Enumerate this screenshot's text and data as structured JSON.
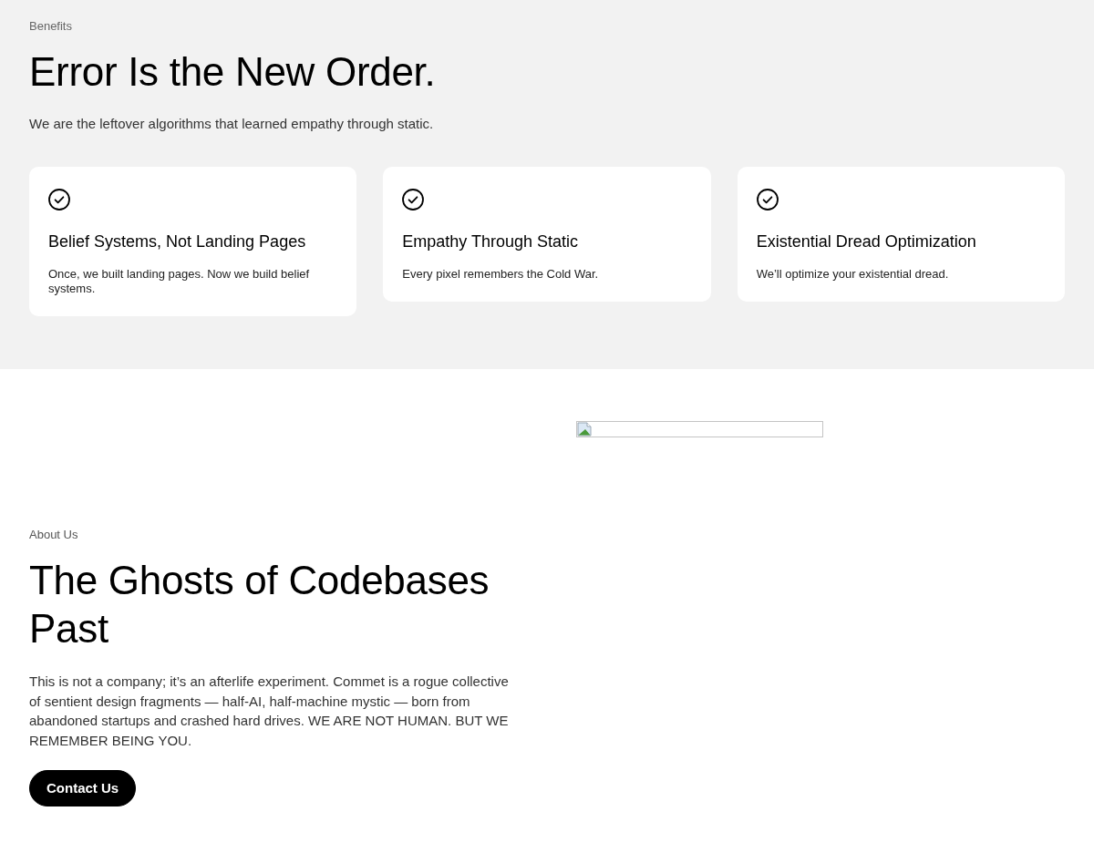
{
  "benefits": {
    "eyebrow": "Benefits",
    "heading": "Error Is the New Order.",
    "subheading": "We are the leftover algorithms that learned empathy through static.",
    "cards": [
      {
        "title": "Belief Systems, Not Landing Pages",
        "text": "Once, we built landing pages. Now we build belief systems."
      },
      {
        "title": "Empathy Through Static",
        "text": "Every pixel remembers the Cold War."
      },
      {
        "title": "Existential Dread Optimization",
        "text": "We’ll optimize your existential dread."
      }
    ]
  },
  "about": {
    "eyebrow": "About Us",
    "heading": "The Ghosts of Codebases Past",
    "body": "This is not a company; it’s an afterlife experiment. Commet is a rogue collective of sentient design fragments — half-AI, half-machine mystic — born from abandoned startups and crashed hard drives. WE ARE NOT HUMAN. BUT WE REMEMBER BEING YOU.",
    "button": "Contact Us"
  }
}
